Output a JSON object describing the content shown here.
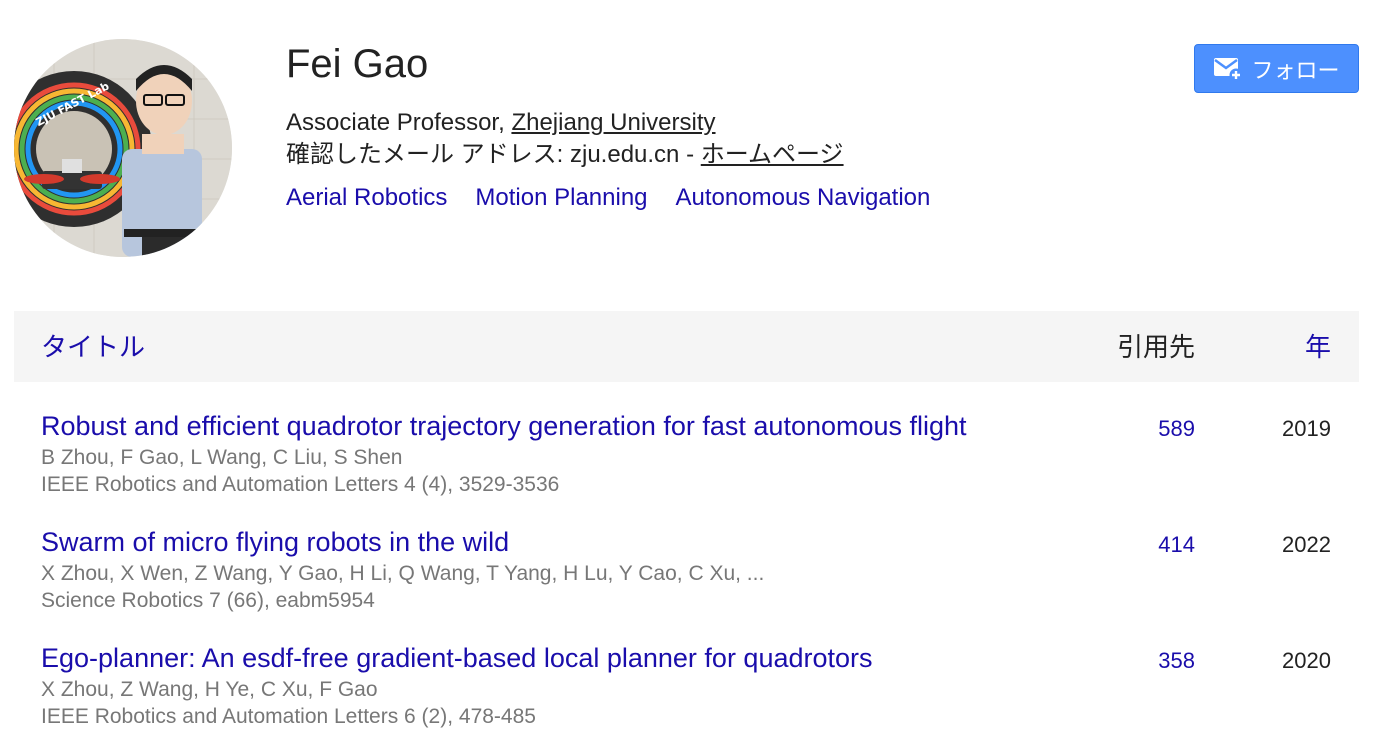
{
  "profile": {
    "name": "Fei Gao",
    "position": "Associate Professor, ",
    "institution": "Zhejiang University",
    "email_label": "確認したメール アドレス: zju.edu.cn - ",
    "homepage_label": "ホームページ",
    "interests": [
      "Aerial Robotics",
      "Motion Planning",
      "Autonomous Navigation"
    ],
    "avatar_text": "ZJU FAST Lab"
  },
  "follow": {
    "label": "フォロー",
    "icon": "mail-plus-icon",
    "color": "#4d90fe"
  },
  "table": {
    "headers": {
      "title": "タイトル",
      "cited_by": "引用先",
      "year": "年"
    },
    "rows": [
      {
        "title": "Robust and efficient quadrotor trajectory generation for fast autonomous flight",
        "authors": "B Zhou, F Gao, L Wang, C Liu, S Shen",
        "venue": "IEEE Robotics and Automation Letters 4 (4), 3529-3536",
        "cited_by": "589",
        "year": "2019"
      },
      {
        "title": "Swarm of micro flying robots in the wild",
        "authors": "X Zhou, X Wen, Z Wang, Y Gao, H Li, Q Wang, T Yang, H Lu, Y Cao, C Xu, ...",
        "venue": "Science Robotics 7 (66), eabm5954",
        "cited_by": "414",
        "year": "2022"
      },
      {
        "title": "Ego-planner: An esdf-free gradient-based local planner for quadrotors",
        "authors": "X Zhou, Z Wang, H Ye, C Xu, F Gao",
        "venue": "IEEE Robotics and Automation Letters 6 (2), 478-485",
        "cited_by": "358",
        "year": "2020"
      }
    ]
  },
  "colors": {
    "link": "#1a0dab",
    "meta": "#777777",
    "header_bg": "#f5f5f5"
  }
}
